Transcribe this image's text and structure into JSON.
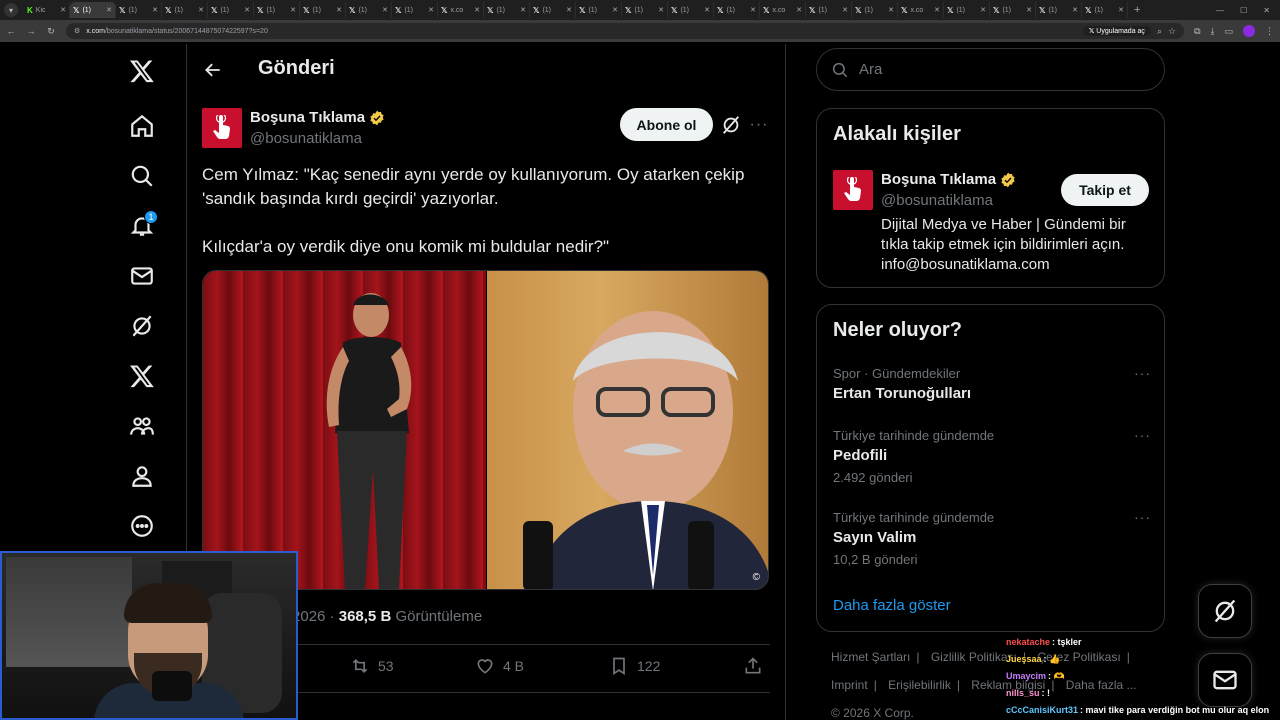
{
  "browser": {
    "tabs": [
      {
        "label": "Kic",
        "icon": "kick-icon",
        "active": false
      },
      {
        "label": "(1) ",
        "icon": "x-icon",
        "active": true
      },
      {
        "label": "(1) ",
        "icon": "x-icon",
        "active": false
      },
      {
        "label": "(1) ",
        "icon": "x-icon",
        "active": false
      },
      {
        "label": "(1) ",
        "icon": "x-icon",
        "active": false
      },
      {
        "label": "(1) ",
        "icon": "x-icon",
        "active": false
      },
      {
        "label": "(1) ",
        "icon": "x-icon",
        "active": false
      },
      {
        "label": "(1) ",
        "icon": "x-icon",
        "active": false
      },
      {
        "label": "(1) ",
        "icon": "x-icon",
        "active": false
      },
      {
        "label": "x.co",
        "icon": "x-icon",
        "active": false
      },
      {
        "label": "(1) ",
        "icon": "x-icon",
        "active": false
      },
      {
        "label": "(1) ",
        "icon": "x-icon",
        "active": false
      },
      {
        "label": "(1) ",
        "icon": "x-icon",
        "active": false
      },
      {
        "label": "(1) ",
        "icon": "x-icon",
        "active": false
      },
      {
        "label": "(1) ",
        "icon": "x-icon",
        "active": false
      },
      {
        "label": "(1) ",
        "icon": "x-icon",
        "active": false
      },
      {
        "label": "x.co",
        "icon": "x-icon",
        "active": false
      },
      {
        "label": "(1) ",
        "icon": "x-icon",
        "active": false
      },
      {
        "label": "(1) ",
        "icon": "x-icon",
        "active": false
      },
      {
        "label": "x.co",
        "icon": "x-icon",
        "active": false
      },
      {
        "label": "(1) ",
        "icon": "x-icon",
        "active": false
      },
      {
        "label": "(1) ",
        "icon": "x-icon",
        "active": false
      },
      {
        "label": "(1) ",
        "icon": "x-icon",
        "active": false
      },
      {
        "label": "(1) ",
        "icon": "x-icon",
        "active": false
      }
    ],
    "url_domain": "x.com",
    "url_path": "/bosunatiklama/status/2006714487507422597?s=20",
    "open_in_app": "Uygulamada aç"
  },
  "nav": {
    "items": [
      {
        "name": "x-logo",
        "icon": "x-logo-icon"
      },
      {
        "name": "home",
        "icon": "home-icon"
      },
      {
        "name": "explore",
        "icon": "search-icon"
      },
      {
        "name": "notifications",
        "icon": "bell-icon"
      },
      {
        "name": "messages",
        "icon": "mail-icon"
      },
      {
        "name": "grok",
        "icon": "grok-icon"
      },
      {
        "name": "premium",
        "icon": "x-logo-icon"
      },
      {
        "name": "communities",
        "icon": "people-icon"
      },
      {
        "name": "profile",
        "icon": "person-icon"
      },
      {
        "name": "more",
        "icon": "more-circle-icon"
      }
    ],
    "notification_badge": "1"
  },
  "post_page": {
    "title": "Gönderi",
    "author": {
      "name": "Boşuna Tıklama",
      "handle": "@bosunatiklama",
      "avatar_color": "#c8102e"
    },
    "subscribe_label": "Abone ol",
    "text_line1": "Cem Yılmaz: \"Kaç senedir aynı yerde oy kullanıyorum. Oy atarken çekip 'sandık başında kırdı geçirdi' yazıyorlar.",
    "text_line2": "Kılıçdar'a oy verdik diye onu komik mi buldular nedir?\"",
    "meta_date": "ca 2026",
    "meta_views": "368,5 B",
    "meta_views_label": "Görüntüleme",
    "actions": {
      "retweets": "53",
      "likes": "4 B",
      "bookmarks": "122"
    }
  },
  "sidebar": {
    "search_placeholder": "Ara",
    "related_title": "Alakalı kişiler",
    "related": {
      "name": "Boşuna Tıklama",
      "handle": "@bosunatiklama",
      "follow_label": "Takip et",
      "bio": "Dijital Medya ve Haber | Gündemi bir tıkla takip etmek için bildirimleri açın. info@bosunatiklama.com"
    },
    "trends_title": "Neler oluyor?",
    "trends": [
      {
        "category": "Spor · Gündemdekiler",
        "name": "Ertan Torunoğulları",
        "count": ""
      },
      {
        "category": "Türkiye tarihinde gündemde",
        "name": "Pedofili",
        "count": "2.492 gönderi"
      },
      {
        "category": "Türkiye tarihinde gündemde",
        "name": "Sayın Valim",
        "count": "10,2 B gönderi"
      }
    ],
    "show_more": "Daha fazla göster",
    "footer": {
      "links_row1": [
        "Hizmet Şartları",
        "Gizlilik Politikası",
        "Çerez Politikası"
      ],
      "links_row2": [
        "Imprint",
        "Erişilebilirlik",
        "Reklam bilgisi",
        "Daha fazla ..."
      ],
      "copyright": "© 2026 X Corp."
    }
  },
  "chat": [
    {
      "user": "nekatache",
      "color": "#ff4d4d",
      "msg": "tşkler"
    },
    {
      "user": "Jueşsaa",
      "color": "#ffd54a",
      "msg": "👍"
    },
    {
      "user": "Umaycim",
      "color": "#c77dff",
      "msg": "🫶"
    },
    {
      "user": "nills_su",
      "color": "#ff8fd0",
      "msg": "!"
    },
    {
      "user": "cCcCanisiKurt31",
      "color": "#5ec8ff",
      "msg": "mavi tike para verdiğin bot mu olur aq elon"
    }
  ],
  "colors": {
    "background": "#000000",
    "accent": "#1d9bf0",
    "border": "#2f3336",
    "muted": "#71767b",
    "verified": "#f2c94c"
  }
}
